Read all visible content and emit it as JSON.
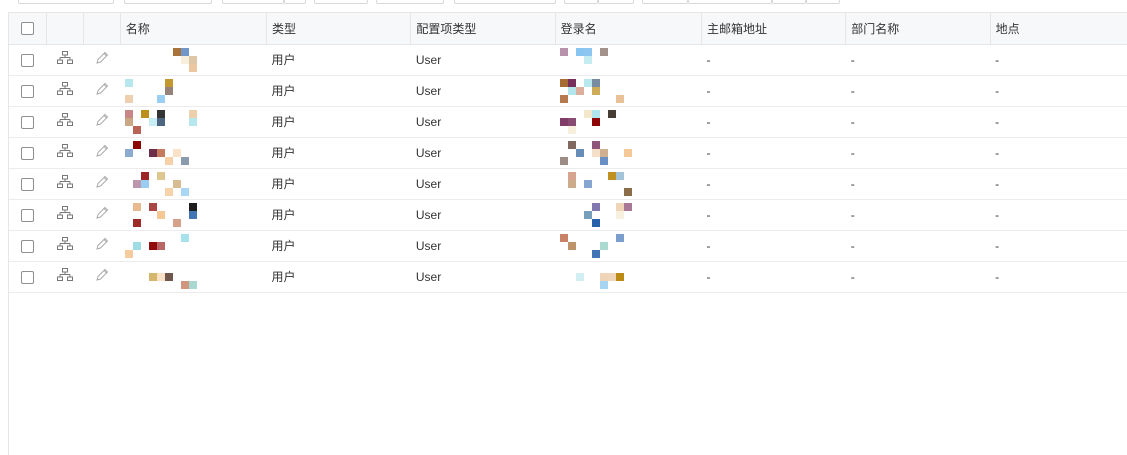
{
  "colors": {
    "header_bg": "#f7f8fa",
    "border": "#e6e6e6",
    "accent": "#3c8dbc"
  },
  "table": {
    "columns": [
      "名称",
      "类型",
      "配置项类型",
      "登录名",
      "主邮箱地址",
      "部门名称",
      "地点"
    ],
    "rows": [
      {
        "type": "用户",
        "ci_type": "User",
        "mail": "-",
        "dept": "-",
        "location": "-"
      },
      {
        "type": "用户",
        "ci_type": "User",
        "mail": "-",
        "dept": "-",
        "location": "-"
      },
      {
        "type": "用户",
        "ci_type": "User",
        "mail": "-",
        "dept": "-",
        "location": "-"
      },
      {
        "type": "用户",
        "ci_type": "User",
        "mail": "-",
        "dept": "-",
        "location": "-"
      },
      {
        "type": "用户",
        "ci_type": "User",
        "mail": "-",
        "dept": "-",
        "location": "-"
      },
      {
        "type": "用户",
        "ci_type": "User",
        "mail": "-",
        "dept": "-",
        "location": "-"
      },
      {
        "type": "用户",
        "ci_type": "User",
        "mail": "-",
        "dept": "-",
        "location": "-"
      },
      {
        "type": "用户",
        "ci_type": "User",
        "mail": "-",
        "dept": "-",
        "location": "-"
      }
    ]
  },
  "icons": {
    "relation": "hierarchy-icon",
    "edit": "pencil-icon",
    "select": "checkbox"
  }
}
